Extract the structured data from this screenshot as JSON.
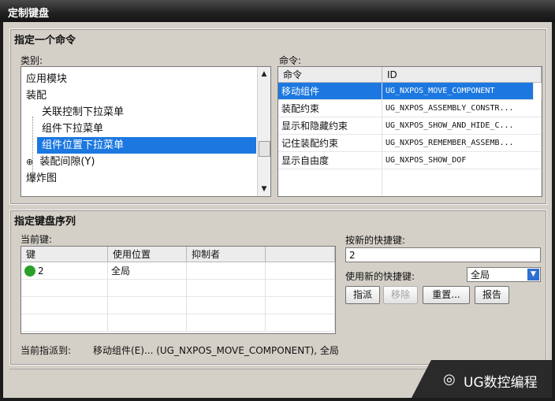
{
  "window": {
    "title": "定制键盘"
  },
  "section1": {
    "title": "指定一个命令",
    "category_label": "类别:",
    "category_items": [
      {
        "label": "应用模块",
        "indent": 0
      },
      {
        "label": "装配",
        "indent": 0
      },
      {
        "label": "关联控制下拉菜单",
        "indent": 1
      },
      {
        "label": "组件下拉菜单",
        "indent": 1
      },
      {
        "label": "组件位置下拉菜单",
        "indent": 1,
        "selected": true
      },
      {
        "label": "装配间隙(Y)",
        "indent": 1,
        "expander": "⊕"
      },
      {
        "label": "爆炸图",
        "indent": 0
      }
    ],
    "command_label": "命令:",
    "command_headers": [
      "命令",
      "ID"
    ],
    "commands": [
      {
        "name": "移动组件",
        "id": "UG_NXPOS_MOVE_COMPONENT",
        "selected": true
      },
      {
        "name": "装配约束",
        "id": "UG_NXPOS_ASSEMBLY_CONSTR..."
      },
      {
        "name": "显示和隐藏约束",
        "id": "UG_NXPOS_SHOW_AND_HIDE_C..."
      },
      {
        "name": "记住装配约束",
        "id": "UG_NXPOS_REMEMBER_ASSEMB..."
      },
      {
        "name": "显示自由度",
        "id": "UG_NXPOS_SHOW_DOF"
      }
    ]
  },
  "section2": {
    "title": "指定键盘序列",
    "current_keys_label": "当前键:",
    "key_headers": [
      "键",
      "使用位置",
      "抑制者"
    ],
    "keys": [
      {
        "key": "2",
        "where": "全局",
        "suppressed_by": ""
      }
    ],
    "new_shortcut_label": "按新的快捷键:",
    "new_shortcut_value": "2",
    "use_new_label": "使用新的快捷键:",
    "use_new_value": "全局",
    "buttons": {
      "assign": "指派",
      "remove": "移除",
      "reset": "重置...",
      "report": "报告"
    },
    "current_assigned_label": "当前指派到:",
    "current_assigned_value": "移动组件(E)...  (UG_NXPOS_MOVE_COMPONENT), 全局"
  },
  "watermark": {
    "text": "UG数控编程"
  },
  "colors": {
    "selection": "#1c78e0",
    "dialog_bg": "#d4d0c8",
    "status_ok": "#2aa02a"
  }
}
